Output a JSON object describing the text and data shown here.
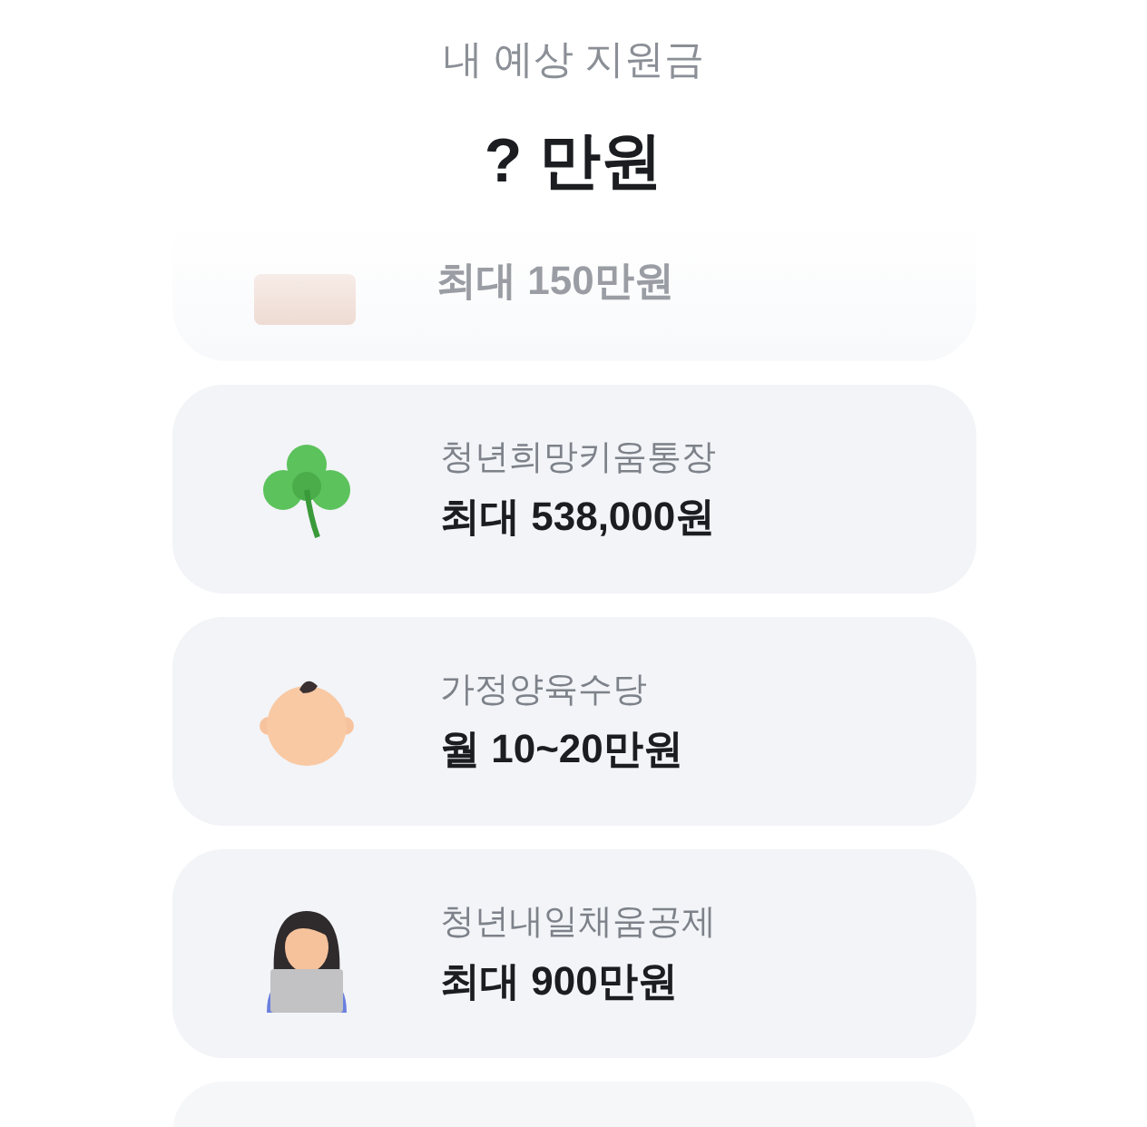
{
  "header": {
    "label": "내 예상 지원금",
    "amount": "? 만원"
  },
  "faded_card": {
    "amount": "최대 150만원"
  },
  "cards": [
    {
      "title": "청년희망키움통장",
      "amount": "최대 538,000원"
    },
    {
      "title": "가정양육수당",
      "amount": "월 10~20만원"
    },
    {
      "title": "청년내일채움공제",
      "amount": "최대 900만원"
    }
  ]
}
